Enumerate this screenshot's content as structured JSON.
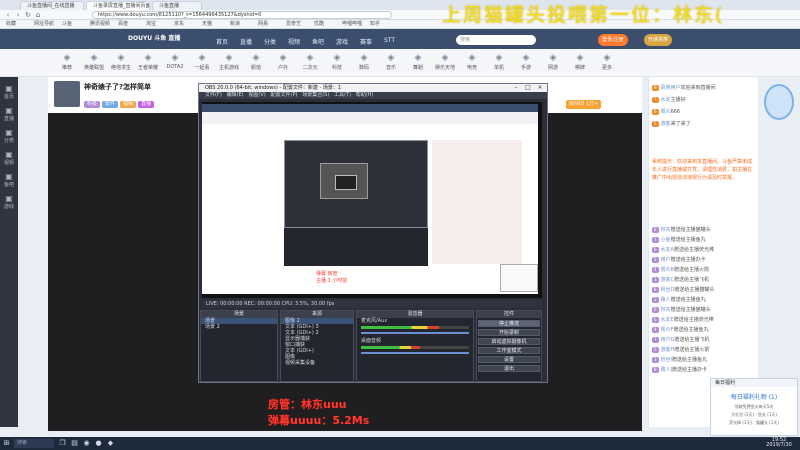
{
  "browser": {
    "tabs": [
      "斗鱼直播间_在线直播",
      "斗鱼录屏直播_直播间页面",
      "斗鱼直播"
    ],
    "url": "https://www.douyu.com/8125110?_t=1564496435127&dyshid=0",
    "bookmarks": [
      "收藏",
      "网址导航",
      "斗鱼",
      "腾讯视频",
      "百度",
      "淘宝",
      "京东",
      "天猫",
      "新浪",
      "网易",
      "爱奇艺",
      "优酷",
      "哔哩哔哩",
      "知乎"
    ]
  },
  "overlay_title": "上周猫罐头投喂第一位：林东(",
  "site": {
    "logo": "DOUYU 斗鱼 直播",
    "nav": [
      "首页",
      "直播",
      "分类",
      "视频",
      "鱼吧",
      "游戏",
      "赛事",
      "STT"
    ],
    "search_placeholder": "搜索",
    "header_buttons": [
      "登录/注册",
      "开通贵族"
    ]
  },
  "categories": [
    "推荐",
    "英雄联盟",
    "绝地求生",
    "王者荣耀",
    "DOTA2",
    "一起看",
    "主机游戏",
    "颜值",
    "户外",
    "二次元",
    "科技",
    "数码",
    "音乐",
    "舞蹈",
    "娱乐天地",
    "电竞",
    "单机",
    "手游",
    "网游",
    "棋牌",
    "更多"
  ],
  "leftnav": [
    "首页",
    "直播",
    "分类",
    "视频",
    "鱼吧",
    "游戏"
  ],
  "room": {
    "title": "神奇婊子了?怎样简单",
    "tags": [
      "科技",
      "软件",
      "视频",
      "直播"
    ],
    "room_id": "房间ID 1万+"
  },
  "obs": {
    "window_title": "OBS 20.0.0 (64-bit, windows) - 配置文件：新建 - 场景：1",
    "menu": [
      "文件(F)",
      "编辑(E)",
      "视图(V)",
      "配置文件(P)",
      "场景集合(S)",
      "工具(T)",
      "帮助(H)"
    ],
    "status": "LIVE: 00:00:00   REC: 00:00:00   CPU: 3.5%, 30.00 fps",
    "docks": {
      "scenes": {
        "title": "场景",
        "items": [
          "场景",
          "场景 2"
        ]
      },
      "sources": {
        "title": "来源",
        "items": [
          "图像 2",
          "文本 (GDI+) 3",
          "文本 (GDI+) 2",
          "显示器捕获",
          "窗口捕获",
          "文本 (GDI+)",
          "图像",
          "视频采集设备"
        ]
      },
      "mixer": {
        "title": "混音器",
        "channels": [
          {
            "name": "麦克风/Aux",
            "level": 0.72
          },
          {
            "name": "桌面音频",
            "level": 0.55
          }
        ]
      },
      "controls": {
        "title": "控件",
        "buttons": [
          "停止推流",
          "开始录制",
          "启动虚拟摄像机",
          "工作室模式",
          "设置",
          "退出"
        ]
      }
    }
  },
  "red_small_text": [
    "弹幕 房管",
    "主播 1 小时前"
  ],
  "big_red_lines": [
    "房管：林东uuu",
    "弹幕uuuu：5.2Ms"
  ],
  "chat": {
    "rows": [
      {
        "badge": "9",
        "name": "贵族用户",
        "text": "欢迎来到直播间"
      },
      {
        "badge": "7",
        "name": "水友",
        "text": "主播好"
      },
      {
        "badge": "6",
        "name": "观众",
        "text": "666"
      },
      {
        "badge": "5",
        "name": "游客",
        "text": "来了来了"
      }
    ],
    "notice": "系统提示：欢迎来到本直播间，斗鱼严禁未成年人进行直播或打赏，请理性消费，如主播在推广中出现违法违规行为请及时举报。",
    "gift_rows": [
      {
        "badge": "8",
        "name": "林东",
        "text": "赠送给主播猫罐头"
      },
      {
        "badge": "7",
        "name": "小鱼",
        "text": "赠送给主播鱼丸"
      },
      {
        "badge": "6",
        "name": "水友A",
        "text": "赠送给主播荧光棒"
      },
      {
        "badge": "5",
        "name": "用户",
        "text": "赠送给主播办卡"
      },
      {
        "badge": "4",
        "name": "观众B",
        "text": "赠送给主播火箭"
      },
      {
        "badge": "3",
        "name": "游客C",
        "text": "赠送给主播飞机"
      },
      {
        "badge": "8",
        "name": "粉丝D",
        "text": "赠送给主播猫罐头"
      },
      {
        "badge": "2",
        "name": "路人",
        "text": "赠送给主播鱼丸"
      },
      {
        "badge": "9",
        "name": "林东",
        "text": "赠送给主播猫罐头"
      },
      {
        "badge": "6",
        "name": "水友E",
        "text": "赠送给主播荧光棒"
      },
      {
        "badge": "4",
        "name": "观众F",
        "text": "赠送给主播鱼丸"
      },
      {
        "badge": "7",
        "name": "用户G",
        "text": "赠送给主播飞机"
      },
      {
        "badge": "5",
        "name": "游客H",
        "text": "赠送给主播火箭"
      },
      {
        "badge": "3",
        "name": "粉丝I",
        "text": "赠送给主播鱼丸"
      },
      {
        "badge": "8",
        "name": "路人J",
        "text": "赠送给主播办卡"
      }
    ]
  },
  "toast": {
    "header": "每日福利",
    "title": "每日福利礼物 (1)",
    "lines": [
      "领取免费鱼丸每天5次",
      "大礼包 (1天)：鱼丸 (1天)",
      "荧光棒 (1天)：猫罐头 (1天)"
    ]
  },
  "taskbar": {
    "search": "搜索",
    "time": "19:52",
    "date": "2019/7/30"
  }
}
